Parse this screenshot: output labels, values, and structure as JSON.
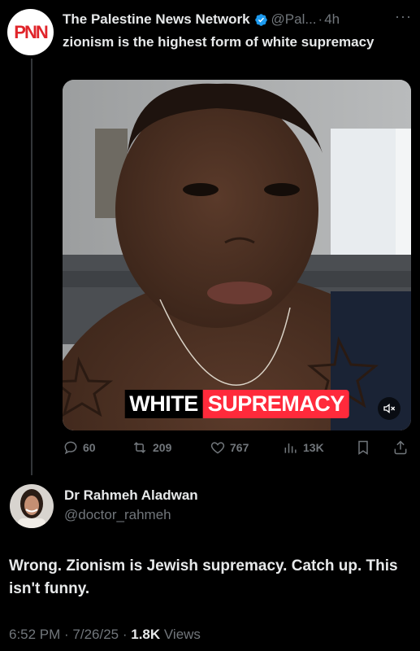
{
  "post": {
    "avatar_text": "PNN",
    "author_name": "The Palestine News Network",
    "handle": "@Pal...",
    "separator": "·",
    "time": "4h",
    "more": "···",
    "text": "zionism is the highest form of white supremacy",
    "media": {
      "caption_part1": "WHITE",
      "caption_part2": "SUPREMACY",
      "mute_icon": "speaker-muted-icon"
    },
    "actions": {
      "replies": "60",
      "reposts": "209",
      "likes": "767",
      "views": "13K"
    }
  },
  "reply": {
    "author_name": "Dr Rahmeh Aladwan",
    "handle": "@doctor_rahmeh",
    "text": "Wrong. Zionism is Jewish supremacy. Catch up. This isn't funny.",
    "timestamp": "6:52 PM · 7/26/25 · ",
    "views_count": "1.8K",
    "views_label": " Views"
  },
  "colors": {
    "background": "#000000",
    "text_primary": "#e7e9ea",
    "text_secondary": "#71767b",
    "verified": "#1d9bf0",
    "caption_highlight": "#ff2a3b"
  }
}
